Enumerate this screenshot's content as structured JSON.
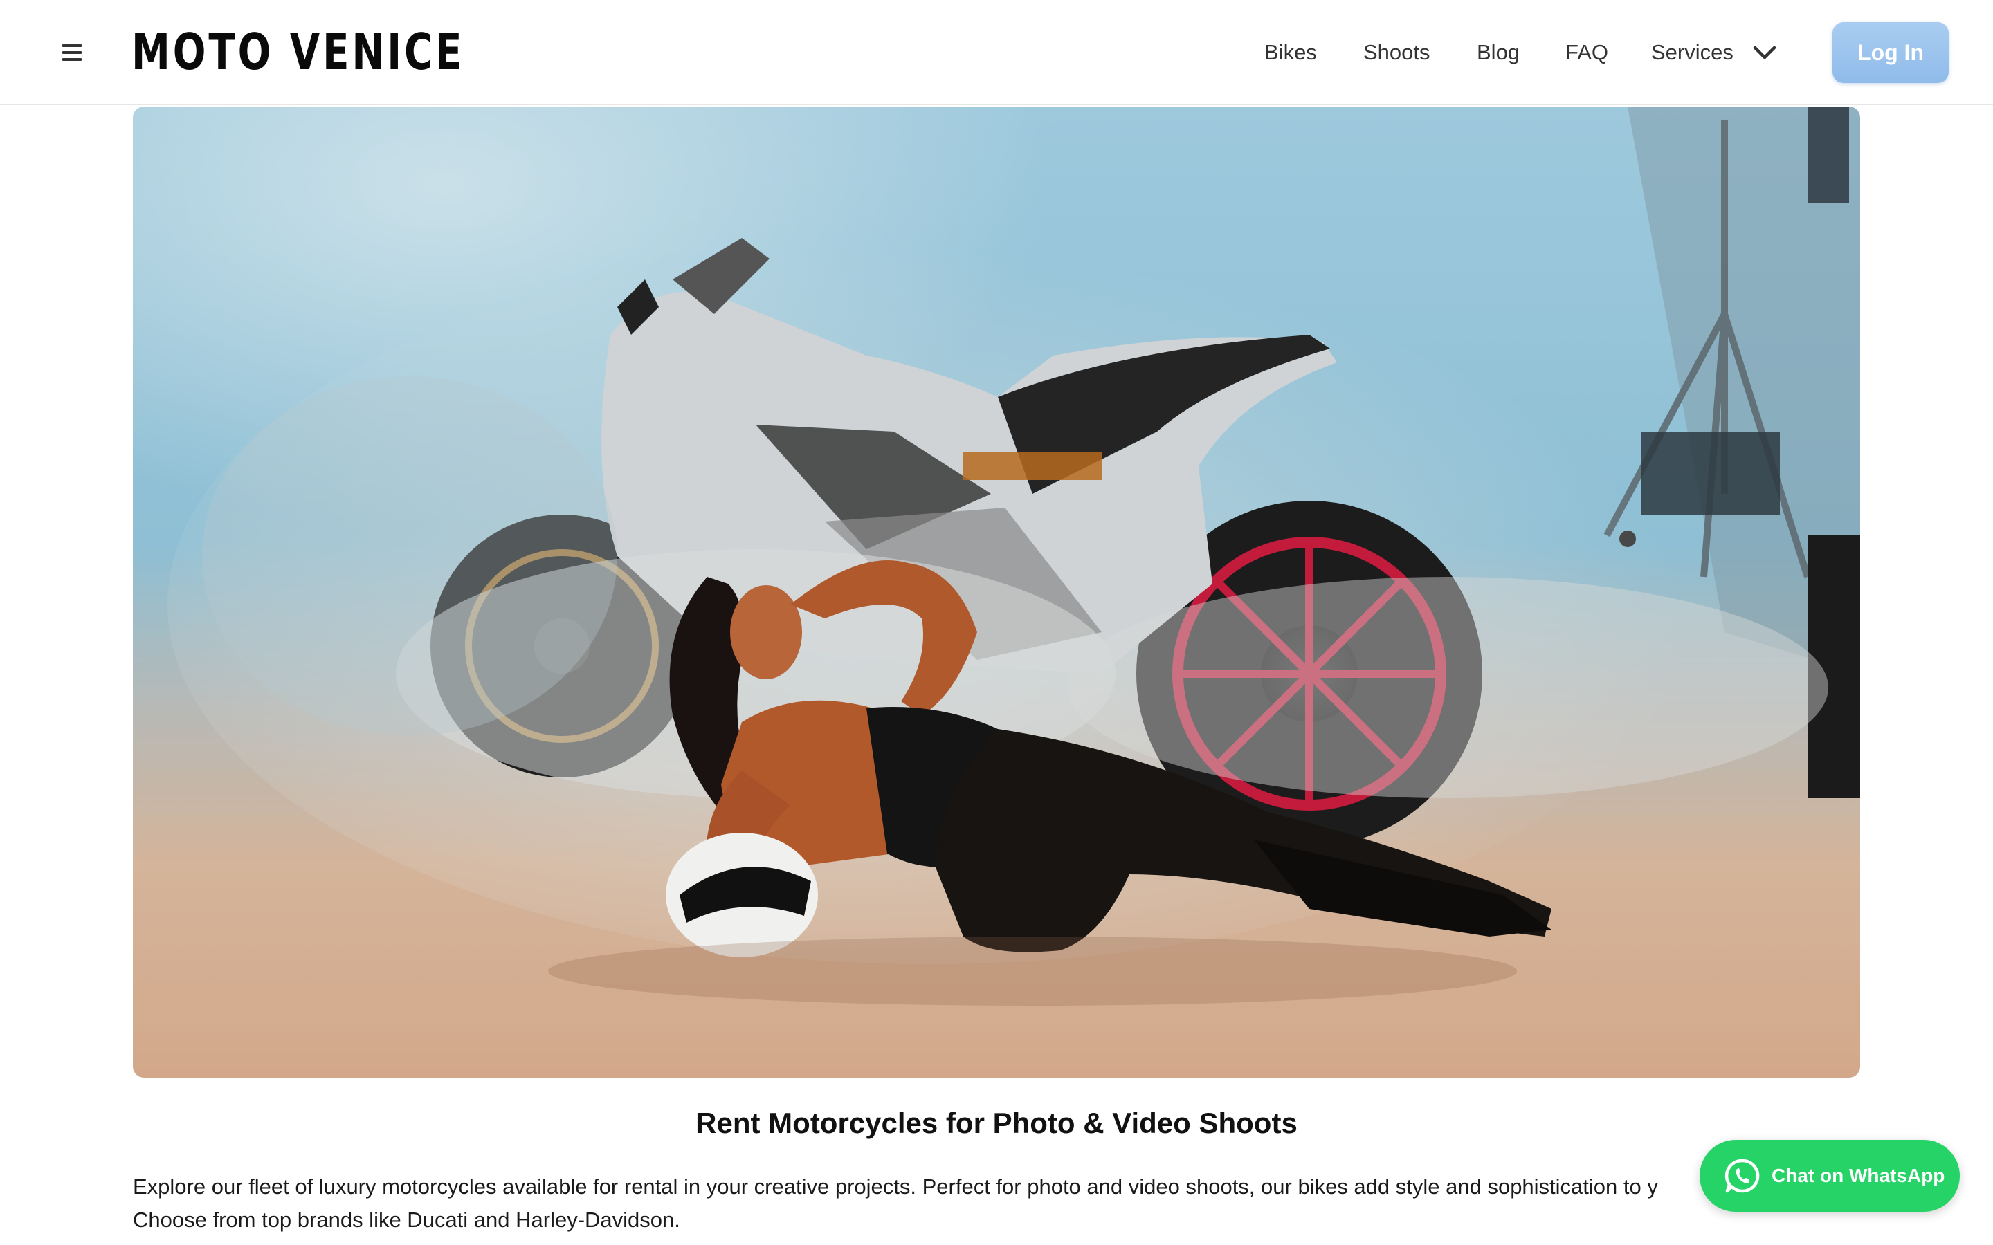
{
  "header": {
    "logo_text": "MOTO VENICE",
    "nav": [
      {
        "label": "Bikes"
      },
      {
        "label": "Shoots"
      },
      {
        "label": "Blog"
      },
      {
        "label": "FAQ"
      },
      {
        "label": "Services"
      }
    ],
    "login_label": "Log In",
    "icons": {
      "menu": "hamburger-menu-icon",
      "services_dropdown": "chevron-down-icon"
    }
  },
  "hero": {
    "icon": "motorcycle-photo-shoot-image"
  },
  "content": {
    "title": "Rent Motorcycles for Photo & Video Shoots",
    "description_line1": "Explore our fleet of luxury motorcycles available for rental in your creative projects. Perfect for photo and video shoots, our bikes add style and sophistication to y",
    "description_line2": "Choose from top brands like Ducati and Harley-Davidson."
  },
  "whatsapp": {
    "label": "Chat on WhatsApp",
    "icon": "whatsapp-icon"
  },
  "colors": {
    "login_button": "#9dc4ee",
    "whatsapp": "#25d366"
  }
}
